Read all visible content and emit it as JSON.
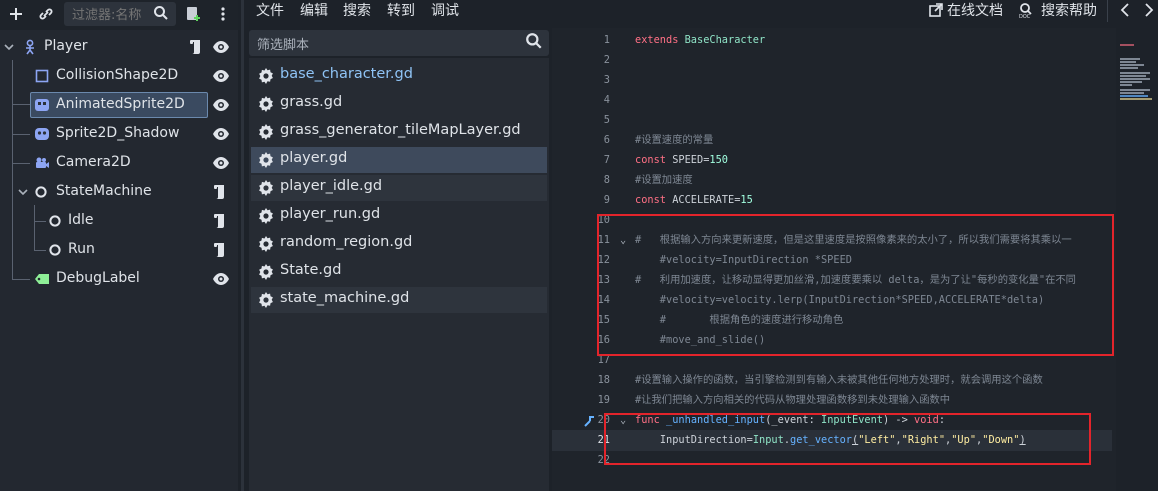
{
  "scene_dock": {
    "filter_placeholder": "过滤器:名称",
    "nodes": [
      {
        "label": "Player",
        "icon": "player-icon",
        "has_script": true
      },
      {
        "label": "CollisionShape2D",
        "icon": "collision-shape-icon"
      },
      {
        "label": "AnimatedSprite2D",
        "icon": "animated-sprite-icon",
        "selected": true
      },
      {
        "label": "Sprite2D_Shadow",
        "icon": "sprite-icon"
      },
      {
        "label": "Camera2D",
        "icon": "camera-icon"
      },
      {
        "label": "StateMachine",
        "icon": "node-icon",
        "has_script": true
      },
      {
        "label": "Idle",
        "icon": "node-icon",
        "has_script": true
      },
      {
        "label": "Run",
        "icon": "node-icon",
        "has_script": true
      },
      {
        "label": "DebugLabel",
        "icon": "label-icon"
      }
    ]
  },
  "menu": {
    "items": [
      "文件",
      "编辑",
      "搜索",
      "转到",
      "调试"
    ],
    "online_docs": "在线文档",
    "search_help": "搜索帮助"
  },
  "scripts": {
    "filter_placeholder": "筛选脚本",
    "items": [
      {
        "name": "base_character.gd",
        "highlight": true
      },
      {
        "name": "grass.gd"
      },
      {
        "name": "grass_generator_tileMapLayer.gd"
      },
      {
        "name": "player.gd",
        "selected": true
      },
      {
        "name": "player_idle.gd"
      },
      {
        "name": "player_run.gd"
      },
      {
        "name": "random_region.gd"
      },
      {
        "name": "State.gd"
      },
      {
        "name": "state_machine.gd"
      }
    ]
  },
  "editor": {
    "line_numbers": [
      "1",
      "2",
      "3",
      "4",
      "5",
      "6",
      "7",
      "8",
      "9",
      "10",
      "11",
      "12",
      "13",
      "14",
      "15",
      "16",
      "17",
      "18",
      "19",
      "20",
      "21",
      "22"
    ],
    "lines": {
      "l1_kw": "extends",
      "l1_cls": "BaseCharacter",
      "l6": "#设置速度的常量",
      "l7_kw": "const",
      "l7_rest": "SPEED=",
      "l7_num": "150",
      "l8": "#设置加速度",
      "l9_kw": "const",
      "l9_rest": "ACCELERATE=",
      "l9_num": "15",
      "l11": "#   根据输入方向来更新速度，但是这里速度是按照像素来的太小了，所以我们需要将其乘以一",
      "l12": "    #velocity=InputDirection *SPEED",
      "l13": "#   利用加速度，让移动显得更加丝滑,加速度要乘以 delta，是为了让\"每秒的变化量\"在不同",
      "l14": "    #velocity=velocity.lerp(InputDirection*SPEED,ACCELERATE*delta)",
      "l15": "    #       根据角色的速度进行移动角色",
      "l16": "    #move_and_slide()",
      "l18": "#设置输入操作的函数，当引擎检测到有输入未被其他任何地方处理时，就会调用这个函数",
      "l19": "#让我们把输入方向相关的代码从物理处理函数移到未处理输入函数中",
      "l20_kw": "func",
      "l20_fn": "_unhandled_input",
      "l20_params": "(_event: ",
      "l20_type": "InputEvent",
      "l20_arrow": ") -> ",
      "l20_void": "void",
      "l20_colon": ":",
      "l21_lhs": "InputDirection=",
      "l21_cls": "Input",
      "l21_dot": ".",
      "l21_fn": "get_vector",
      "l21_open": "(",
      "l21_s1": "\"Left\"",
      "l21_s2": "\"Right\"",
      "l21_s3": "\"Up\"",
      "l21_s4": "\"Down\"",
      "l21_close": ")",
      "comma": ","
    }
  },
  "colors": {
    "accent_blue": "#66b2ff",
    "keyword": "#ff7085",
    "string": "#ffeda1",
    "annotation_red": "#e3242b"
  }
}
